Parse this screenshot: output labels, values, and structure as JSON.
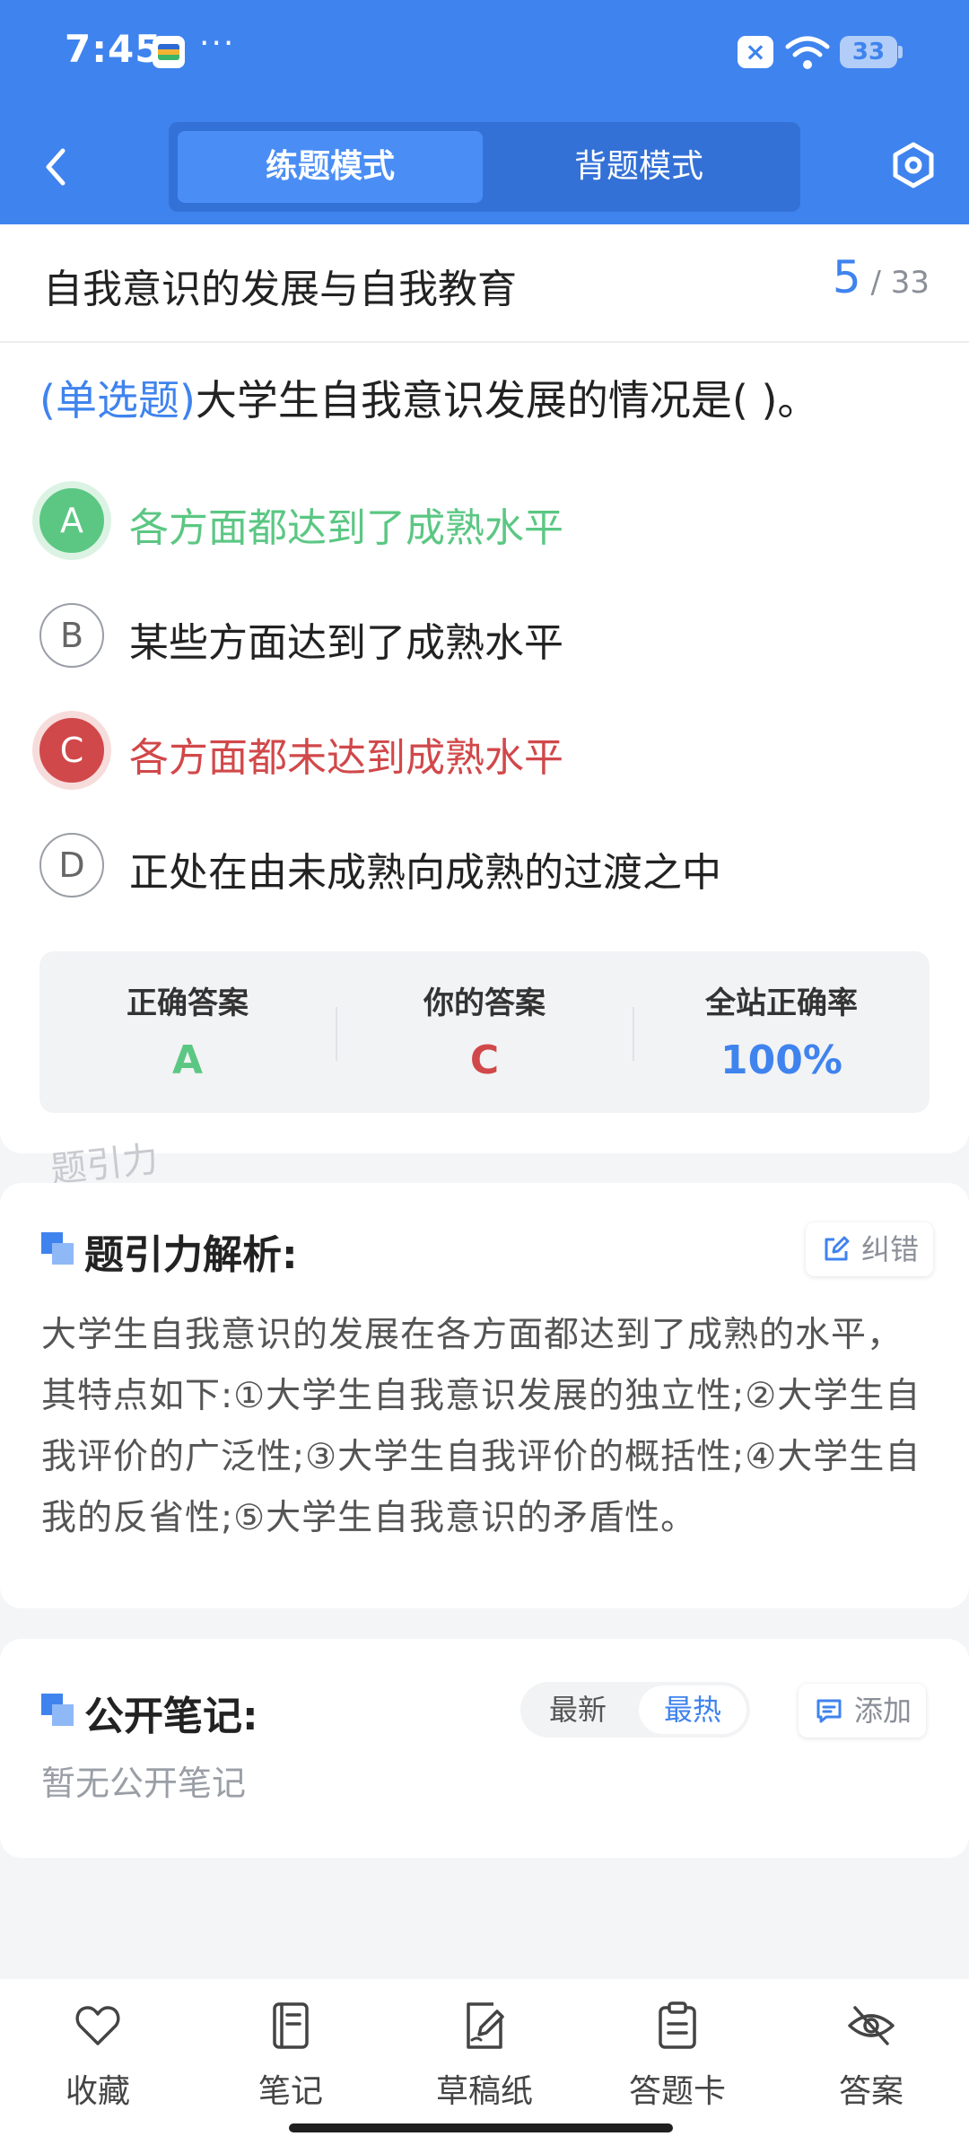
{
  "status_bar": {
    "time": "7:45",
    "more": "···",
    "battery": "33"
  },
  "header": {
    "tabs": [
      "练题模式",
      "背题模式"
    ],
    "active_tab": 0
  },
  "question_card": {
    "chapter_title": "自我意识的发展与自我教育",
    "current": "5",
    "total": "/ 33",
    "question_type": "(单选题)",
    "question_text": "大学生自我意识发展的情况是(        )。",
    "options": [
      {
        "letter": "A",
        "text": "各方面都达到了成熟水平",
        "state": "correct"
      },
      {
        "letter": "B",
        "text": "某些方面达到了成熟水平",
        "state": "normal"
      },
      {
        "letter": "C",
        "text": "各方面都未达到成熟水平",
        "state": "wrong"
      },
      {
        "letter": "D",
        "text": "正处在由未成熟向成熟的过渡之中",
        "state": "normal"
      }
    ],
    "answers": {
      "correct_label": "正确答案",
      "correct_value": "A",
      "yours_label": "你的答案",
      "yours_value": "C",
      "rate_label": "全站正确率",
      "rate_value": "100%"
    }
  },
  "watermark": "题引力",
  "explanation": {
    "title": "题引力解析:",
    "report_label": "纠错",
    "text": "大学生自我意识的发展在各方面都达到了成熟的水平，其特点如下:①大学生自我意识发展的独立性;②大学生自我评价的广泛性;③大学生自我评价的概括性;④大学生自我的反省性;⑤大学生自我意识的矛盾性。"
  },
  "notes": {
    "title": "公开笔记:",
    "sort_latest": "最新",
    "sort_hot": "最热",
    "active_sort": "最热",
    "add_label": "添加",
    "empty_text": "暂无公开笔记"
  },
  "bottom_nav": [
    {
      "label": "收藏",
      "icon": "heart-icon"
    },
    {
      "label": "笔记",
      "icon": "notebook-icon"
    },
    {
      "label": "草稿纸",
      "icon": "draft-icon"
    },
    {
      "label": "答题卡",
      "icon": "clipboard-icon"
    },
    {
      "label": "答案",
      "icon": "eye-off-icon"
    }
  ],
  "colors": {
    "primary": "#3F83EE",
    "correct": "#5BC783",
    "wrong": "#D1484A"
  }
}
